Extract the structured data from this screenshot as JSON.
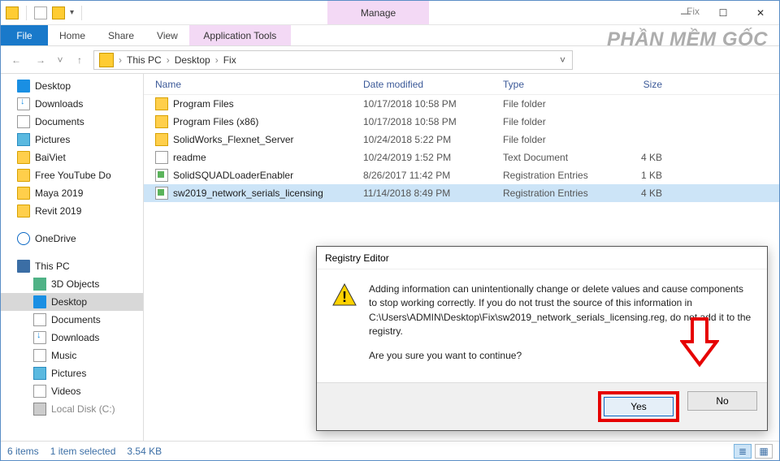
{
  "window": {
    "context_group_label": "Manage",
    "title": "Fix",
    "minimize": "—",
    "maximize": "☐",
    "close": "✕"
  },
  "ribbon": {
    "file_tab": "File",
    "home_tab": "Home",
    "share_tab": "Share",
    "view_tab": "View",
    "context_tab": "Application Tools"
  },
  "watermark": "PHẦN MỀM GỐC",
  "nav": {
    "back": "←",
    "forward": "→",
    "recent": "˅",
    "up": "↑",
    "refresh": "↻"
  },
  "breadcrumb": {
    "item1": "This PC",
    "item2": "Desktop",
    "item3": "Fix",
    "sep": "›"
  },
  "sidebar": {
    "desktop": "Desktop",
    "downloads": "Downloads",
    "documents": "Documents",
    "pictures": "Pictures",
    "baiviet": "BaiViet",
    "freeyt": "Free YouTube Do",
    "maya": "Maya 2019",
    "revit": "Revit 2019",
    "onedrive": "OneDrive",
    "thispc": "This PC",
    "objects3d": "3D Objects",
    "desktop2": "Desktop",
    "documents2": "Documents",
    "downloads2": "Downloads",
    "music": "Music",
    "pictures2": "Pictures",
    "videos": "Videos",
    "localdisk": "Local Disk (C:)"
  },
  "columns": {
    "name": "Name",
    "date": "Date modified",
    "type": "Type",
    "size": "Size"
  },
  "files": [
    {
      "name": "Program Files",
      "date": "10/17/2018 10:58 PM",
      "type": "File folder",
      "size": "",
      "icon": "folder"
    },
    {
      "name": "Program Files (x86)",
      "date": "10/17/2018 10:58 PM",
      "type": "File folder",
      "size": "",
      "icon": "folder"
    },
    {
      "name": "SolidWorks_Flexnet_Server",
      "date": "10/24/2018 5:22 PM",
      "type": "File folder",
      "size": "",
      "icon": "folder"
    },
    {
      "name": "readme",
      "date": "10/24/2019 1:52 PM",
      "type": "Text Document",
      "size": "4 KB",
      "icon": "txt"
    },
    {
      "name": "SolidSQUADLoaderEnabler",
      "date": "8/26/2017 11:42 PM",
      "type": "Registration Entries",
      "size": "1 KB",
      "icon": "reg"
    },
    {
      "name": "sw2019_network_serials_licensing",
      "date": "11/14/2018 8:49 PM",
      "type": "Registration Entries",
      "size": "4 KB",
      "icon": "reg"
    }
  ],
  "status": {
    "count": "6 items",
    "selected": "1 item selected",
    "size": "3.54 KB"
  },
  "dialog": {
    "title": "Registry Editor",
    "msg": "Adding information can unintentionally change or delete values and cause components to stop working correctly. If you do not trust the source of this information in C:\\Users\\ADMIN\\Desktop\\Fix\\sw2019_network_serials_licensing.reg, do not add it to the registry.",
    "confirm": "Are you sure you want to continue?",
    "yes": "Yes",
    "no": "No"
  }
}
